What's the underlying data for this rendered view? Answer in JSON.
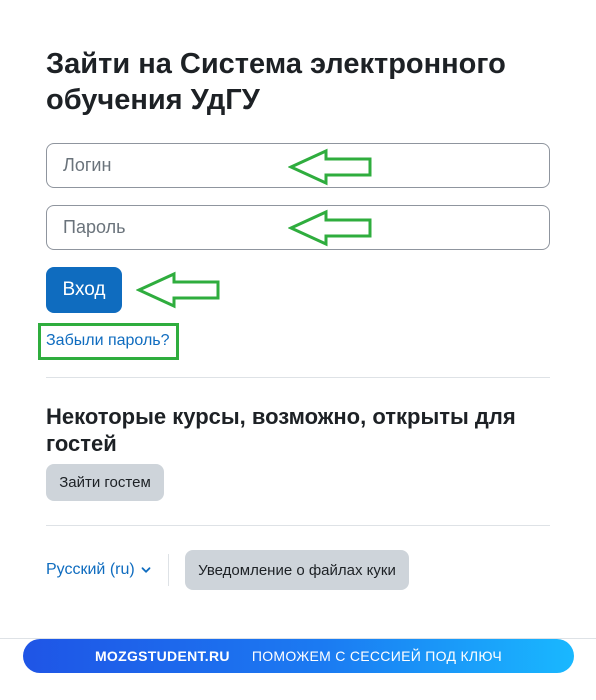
{
  "login": {
    "title": "Зайти на Система электронного обучения УдГУ",
    "username_placeholder": "Логин",
    "password_placeholder": "Пароль",
    "submit_label": "Вход",
    "forgot_link": "Забыли пароль?"
  },
  "guest": {
    "heading": "Некоторые курсы, возможно, открыты для гостей",
    "button_label": "Зайти гостем"
  },
  "footer": {
    "language_label": "Русский (ru)",
    "cookies_label": "Уведомление о файлах куки"
  },
  "banner": {
    "brand": "MOZGSTUDENT.RU",
    "text": "ПОМОЖЕМ С СЕССИЕЙ ПОД КЛЮЧ"
  },
  "colors": {
    "primary": "#0f6cbf",
    "annotation_green": "#2fad3e",
    "secondary_button": "#ced4da",
    "text": "#1d2125"
  },
  "icons": {
    "language_chevron": "chevron-down-icon",
    "annotation": "left-arrow-icon"
  }
}
